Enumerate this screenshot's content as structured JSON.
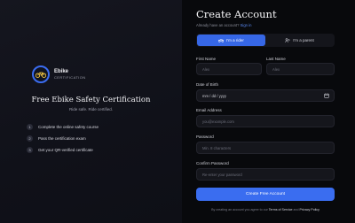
{
  "brand": {
    "name": "Ebike",
    "subtitle": "CERTIFICATION",
    "accent_color": "#3b6cf0",
    "logo_icon": "bicycle-icon"
  },
  "left": {
    "headline": "Free Ebike Safety Certification",
    "tagline": "Ride safe. Ride certified.",
    "steps": [
      {
        "num": "1",
        "text": "Complete the online safety course"
      },
      {
        "num": "2",
        "text": "Pass the certification exam"
      },
      {
        "num": "3",
        "text": "Get your QR-verified certificate"
      }
    ]
  },
  "form": {
    "title": "Create Account",
    "signin_prompt": "Already have an account?",
    "signin_link": "Sign in",
    "roles": [
      {
        "label": "I'm a rider",
        "icon": "rider-icon",
        "active": true
      },
      {
        "label": "I'm a parent",
        "icon": "parent-icon",
        "active": false
      }
    ],
    "first_name": {
      "label": "First Name",
      "placeholder": "Alex"
    },
    "last_name": {
      "label": "Last Name",
      "placeholder": "Alex"
    },
    "dob": {
      "label": "Date of Birth",
      "value": "mm / dd / yyyy"
    },
    "email": {
      "label": "Email Address",
      "placeholder": "you@example.com"
    },
    "password": {
      "label": "Password",
      "placeholder": "Min. 8 characters"
    },
    "confirm": {
      "label": "Confirm Password",
      "placeholder": "Re-enter your password"
    },
    "submit_label": "Create Free Account",
    "terms_prefix": "By creating an account you agree to our",
    "terms_link": "Terms of Service",
    "terms_and": "and",
    "privacy_link": "Privacy Policy"
  },
  "colors": {
    "primary_button": "#3a6df0",
    "link": "#5b8af5",
    "background_dark": "#08090c"
  }
}
